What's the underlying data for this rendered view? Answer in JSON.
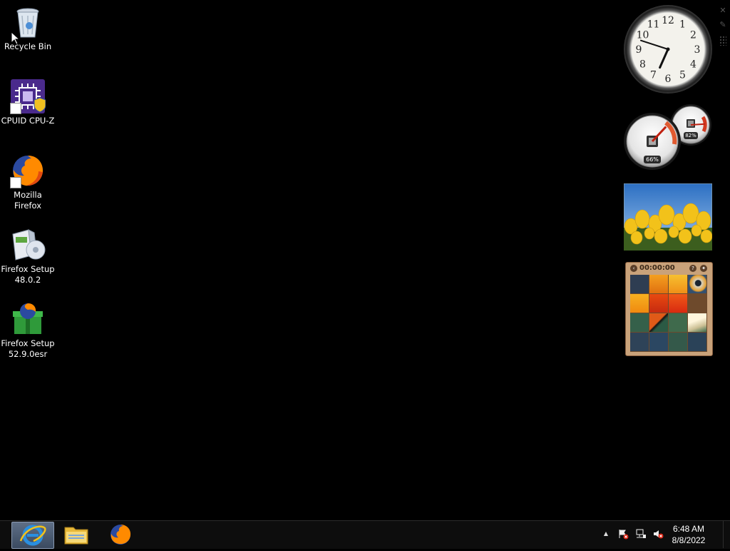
{
  "desktop_icons": [
    {
      "name": "recycle-bin",
      "label": "Recycle Bin",
      "icon": "recycle-bin-icon"
    },
    {
      "name": "cpuz",
      "label": "CPUID CPU-Z",
      "icon": "cpu-chip-icon"
    },
    {
      "name": "firefox",
      "label_lines": [
        "Mozilla",
        "Firefox"
      ],
      "icon": "firefox-icon"
    },
    {
      "name": "firefox-setup-48",
      "label_lines": [
        "Firefox Setup",
        "48.0.2"
      ],
      "icon": "installer-icon"
    },
    {
      "name": "firefox-setup-52",
      "label_lines": [
        "Firefox Setup",
        "52.9.0esr"
      ],
      "icon": "installer-gift-icon"
    }
  ],
  "gadgets": {
    "clock": {
      "numerals": [
        "12",
        "1",
        "2",
        "3",
        "4",
        "5",
        "6",
        "7",
        "8",
        "9",
        "10",
        "11"
      ],
      "time_shown": "6:48"
    },
    "cpu_meter": {
      "cpu_percent": "66%",
      "memory_percent": "82%",
      "cpu_value": 66,
      "memory_value": 82
    },
    "slideshow": {
      "subject": "yellow tulips"
    },
    "puzzle": {
      "timer": "00:00:00",
      "help_icon": "?"
    }
  },
  "taskbar": {
    "buttons": [
      {
        "name": "internet-explorer",
        "icon": "ie-icon",
        "active": true
      },
      {
        "name": "file-explorer",
        "icon": "folder-icon",
        "active": false
      },
      {
        "name": "firefox",
        "icon": "firefox-icon",
        "active": false
      }
    ],
    "tray": {
      "show_hidden": "▲",
      "time": "6:48 AM",
      "date": "8/8/2022"
    }
  },
  "colors": {
    "desktop": "#000000",
    "taskbar": "#0d0d0d",
    "firefox_orange": "#ff7b00",
    "ie_blue": "#2a8fe0"
  }
}
